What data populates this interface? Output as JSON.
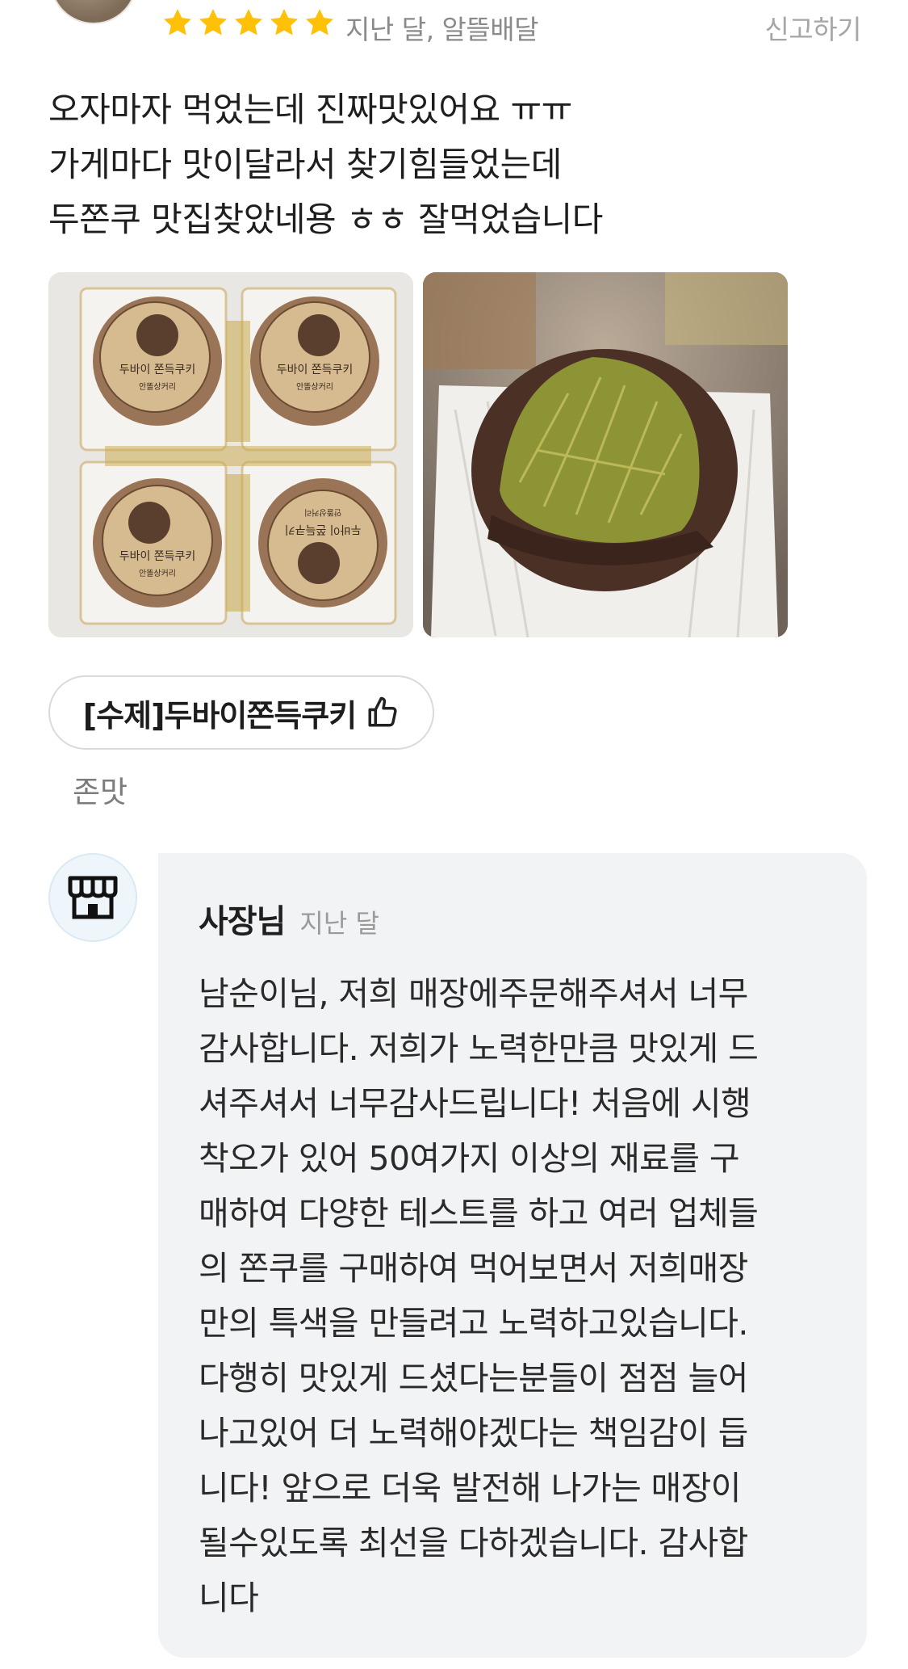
{
  "review": {
    "rating": 5,
    "meta": "지난 달, 알뜰배달",
    "report_label": "신고하기",
    "text_lines": [
      "오자마자 먹었는데 진짜맛있어요 ㅠㅠ",
      "가게마다 맛이달라서 찾기힘들었는데",
      "두쫀쿠 맛집찾았네용 ㅎㅎ 잘먹었습니다"
    ],
    "menu_tag": "[수제]두바이쫀득쿠키",
    "menu_comment": "존맛",
    "photos": {
      "photo1_labels": [
        "두바이 쫀득쿠키",
        "안똘상커리"
      ],
      "photo2_description_icon": "cookie-cross-section"
    }
  },
  "colors": {
    "star": "#FFC107",
    "reply_bg": "#F2F3F5",
    "text": "#1E1E1E",
    "muted": "#8A8A8A"
  },
  "owner_reply": {
    "name": "사장님",
    "time": "지난 달",
    "icon": "store-icon",
    "text_lines": [
      "남순이님, 저희 매장에주문해주셔서 너무",
      "감사합니다. 저희가 노력한만큼 맛있게 드",
      "셔주셔서 너무감사드립니다! 처음에 시행",
      "착오가 있어 50여가지 이상의 재료를 구",
      "매하여 다양한 테스트를 하고 여러 업체들",
      "의 쫀쿠를 구매하여 먹어보면서 저희매장",
      "만의 특색을 만들려고 노력하고있습니다.",
      "다행히 맛있게 드셨다는분들이 점점 늘어",
      "나고있어 더 노력해야겠다는 책임감이 듭",
      "니다! 앞으로 더욱 발전해 나가는 매장이",
      "될수있도록 최선을 다하겠습니다. 감사합",
      "니다"
    ]
  }
}
